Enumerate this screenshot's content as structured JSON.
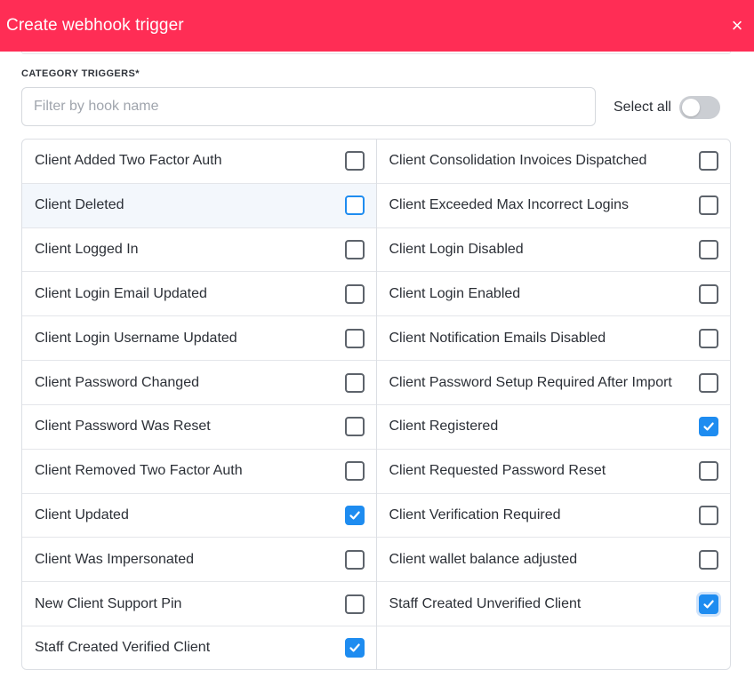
{
  "modal": {
    "title": "Create webhook trigger",
    "close_icon": "×"
  },
  "section_label": "CATEGORY TRIGGERS*",
  "filter": {
    "placeholder": "Filter by hook name",
    "value": ""
  },
  "select_all": {
    "label": "Select all",
    "enabled": false
  },
  "colors": {
    "header": "#ff2d55",
    "checkbox_accent": "#1e8cf0"
  },
  "triggers": {
    "left": [
      {
        "label": "Client Added Two Factor Auth",
        "checked": false
      },
      {
        "label": "Client Deleted",
        "checked": false
      },
      {
        "label": "Client Logged In",
        "checked": false
      },
      {
        "label": "Client Login Email Updated",
        "checked": false
      },
      {
        "label": "Client Login Username Updated",
        "checked": false
      },
      {
        "label": "Client Password Changed",
        "checked": false
      },
      {
        "label": "Client Password Was Reset",
        "checked": false
      },
      {
        "label": "Client Removed Two Factor Auth",
        "checked": false
      },
      {
        "label": "Client Updated",
        "checked": true
      },
      {
        "label": "Client Was Impersonated",
        "checked": false
      },
      {
        "label": "New Client Support Pin",
        "checked": false
      },
      {
        "label": "Staff Created Verified Client",
        "checked": true
      }
    ],
    "right": [
      {
        "label": "Client Consolidation Invoices Dispatched",
        "checked": false
      },
      {
        "label": "Client Exceeded Max Incorrect Logins",
        "checked": false
      },
      {
        "label": "Client Login Disabled",
        "checked": false
      },
      {
        "label": "Client Login Enabled",
        "checked": false
      },
      {
        "label": "Client Notification Emails Disabled",
        "checked": false
      },
      {
        "label": "Client Password Setup Required After Import",
        "checked": false
      },
      {
        "label": "Client Registered",
        "checked": true
      },
      {
        "label": "Client Requested Password Reset",
        "checked": false
      },
      {
        "label": "Client Verification Required",
        "checked": false
      },
      {
        "label": "Client wallet balance adjusted",
        "checked": false
      },
      {
        "label": "Staff Created Unverified Client",
        "checked": true
      }
    ]
  }
}
